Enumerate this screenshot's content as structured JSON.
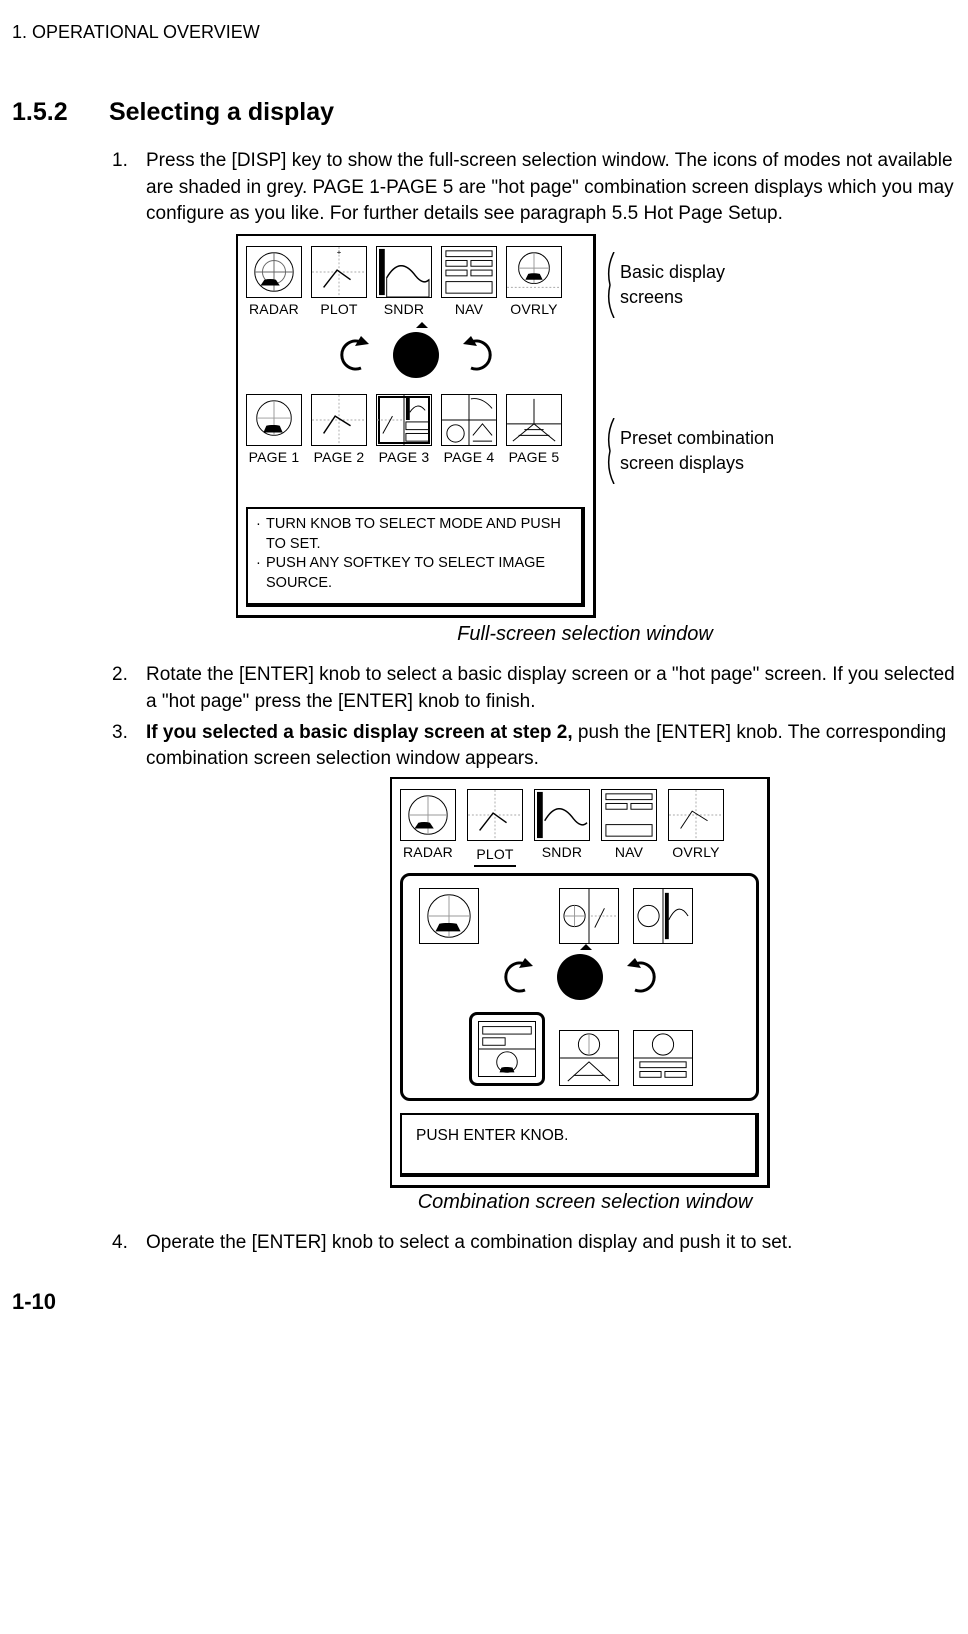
{
  "header": "1. OPERATIONAL OVERVIEW",
  "section": {
    "number": "1.5.2",
    "title": "Selecting a display"
  },
  "steps": {
    "s1": "Press the [DISP] key to show the full-screen selection window. The icons of modes not available are shaded in grey. PAGE 1-PAGE 5 are \"hot page\" combination screen displays which you may configure as you like. For further details see paragraph 5.5 Hot Page Setup.",
    "s2": "Rotate the [ENTER] knob to select a basic display screen or a \"hot page\" screen. If you selected a \"hot page\" press the [ENTER] knob to finish.",
    "s3_bold": "If you selected a basic display screen at step 2,",
    "s3_rest": " push the [ENTER] knob. The corresponding combination screen selection window appears.",
    "s4": "Operate the [ENTER] knob to select a combination display and push it to set."
  },
  "fig1": {
    "basic": [
      "RADAR",
      "PLOT",
      "SNDR",
      "NAV",
      "OVRLY"
    ],
    "pages": [
      "PAGE 1",
      "PAGE 2",
      "PAGE 3",
      "PAGE 4",
      "PAGE 5"
    ],
    "msg1a": "TURN KNOB TO SELECT MODE AND PUSH",
    "msg1b": "TO SET.",
    "msg2a": "PUSH ANY SOFTKEY TO SELECT IMAGE",
    "msg2b": "SOURCE.",
    "annot1": "Basic display screens",
    "annot2": "Preset combination screen displays",
    "caption": "Full-screen selection window"
  },
  "fig2": {
    "basic": [
      "RADAR",
      "PLOT",
      "SNDR",
      "NAV",
      "OVRLY"
    ],
    "msg": "PUSH ENTER KNOB.",
    "caption": "Combination screen selection window"
  },
  "pageNumber": "1-10"
}
